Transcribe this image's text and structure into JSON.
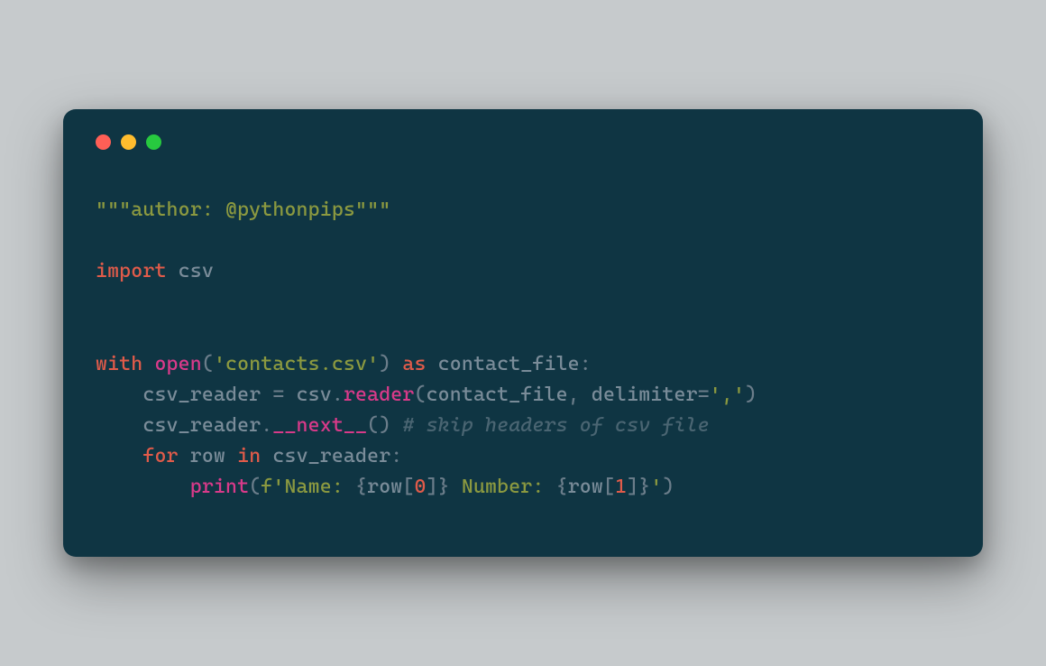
{
  "window": {
    "traffic_lights": {
      "red": "#ff5f56",
      "yellow": "#ffbd2e",
      "green": "#27c93f"
    }
  },
  "code": {
    "docstring_open": "\"\"\"",
    "docstring_text": "author: @pythonpips",
    "docstring_close": "\"\"\"",
    "kw_import": "import",
    "mod_csv": " csv",
    "kw_with": "with",
    "fn_open": "open",
    "paren_open": "(",
    "str_contacts": "'contacts.csv'",
    "paren_close": ")",
    "kw_as": "as",
    "var_contact_file": " contact_file",
    "colon": ":",
    "indent1": "    ",
    "var_csv_reader": "csv_reader",
    "op_eq": " = ",
    "csv_ref": "csv",
    "dot": ".",
    "attr_reader": "reader",
    "arg_contact_file": "contact_file",
    "comma_sp": ", ",
    "param_delimiter": "delimiter",
    "op_eq2": "=",
    "str_comma": "','",
    "attr_next": "__next__",
    "empty_call": "()",
    "comment_skip": " # skip headers of csv file",
    "kw_for": "for",
    "var_row": " row ",
    "kw_in": "in",
    "var_csv_reader2": " csv_reader",
    "indent2": "        ",
    "fn_print": "print",
    "fstr_prefix": "f",
    "str_q": "'",
    "fstr_name": "Name: ",
    "brace_open": "{",
    "row_ref": "row",
    "bracket_open": "[",
    "num_0": "0",
    "bracket_close": "]",
    "brace_close": "}",
    "fstr_number": " Number: ",
    "num_1": "1",
    "space": " "
  }
}
